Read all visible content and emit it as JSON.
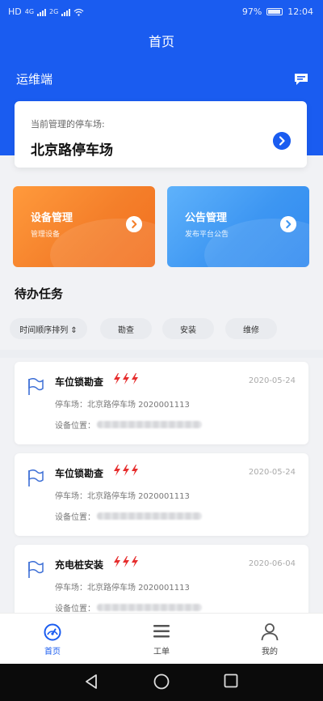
{
  "status_bar": {
    "left_text": "HD",
    "signal_1": "4G",
    "signal_2": "2G",
    "battery": "97%",
    "time": "12:04"
  },
  "nav": {
    "title": "首页"
  },
  "header": {
    "role_label": "运维端"
  },
  "lot_card": {
    "caption": "当前管理的停车场:",
    "name": "北京路停车场"
  },
  "tiles": [
    {
      "title": "设备管理",
      "subtitle": "管理设备"
    },
    {
      "title": "公告管理",
      "subtitle": "发布平台公告"
    }
  ],
  "todo": {
    "title": "待办任务",
    "sort_label": "时间顺序排列 ⇕",
    "filters": [
      "勘查",
      "安装",
      "维修"
    ]
  },
  "tasks": [
    {
      "title": "车位锁勘查",
      "date": "2020-05-24",
      "lot_label": "停车场：",
      "lot_value": "北京路停车场 2020001113",
      "location_label": "设备位置："
    },
    {
      "title": "车位锁勘查",
      "date": "2020-05-24",
      "lot_label": "停车场：",
      "lot_value": "北京路停车场 2020001113",
      "location_label": "设备位置："
    },
    {
      "title": "充电桩安装",
      "date": "2020-06-04",
      "lot_label": "停车场：",
      "lot_value": "北京路停车场 2020001113",
      "location_label": "设备位置："
    }
  ],
  "tabbar": {
    "items": [
      "首页",
      "工单",
      "我的"
    ],
    "active_color": "#1a5cf0"
  },
  "colors": {
    "primary": "#1a5cf0",
    "urgent": "#e62e2e",
    "device_tile": "#f47f2a",
    "notice_tile": "#3d96f2"
  }
}
